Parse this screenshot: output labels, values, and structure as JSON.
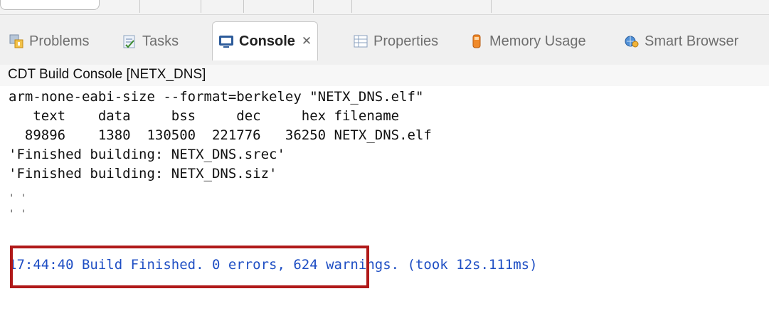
{
  "tabs": [
    {
      "label": "Problems",
      "icon": "problems-icon"
    },
    {
      "label": "Tasks",
      "icon": "tasks-icon"
    },
    {
      "label": "Console",
      "icon": "console-icon",
      "active": true,
      "close": "✕"
    },
    {
      "label": "Properties",
      "icon": "properties-icon"
    },
    {
      "label": "Memory Usage",
      "icon": "memory-usage-icon"
    },
    {
      "label": "Smart Browser",
      "icon": "smart-browser-icon"
    }
  ],
  "console": {
    "title": "CDT Build Console [NETX_DNS]",
    "lines": [
      "arm-none-eabi-size --format=berkeley \"NETX_DNS.elf\"",
      "   text    data     bss     dec     hex filename",
      "  89896    1380  130500  221776   36250 NETX_DNS.elf",
      "'Finished building: NETX_DNS.srec'",
      "'Finished building: NETX_DNS.siz'",
      "' '",
      "' '",
      "17:44:40 Build Finished. 0 errors, 624 warnings. (took 12s.111ms)"
    ]
  },
  "colors": {
    "highlight": "#b01919",
    "status_text": "#1f4fc4"
  }
}
